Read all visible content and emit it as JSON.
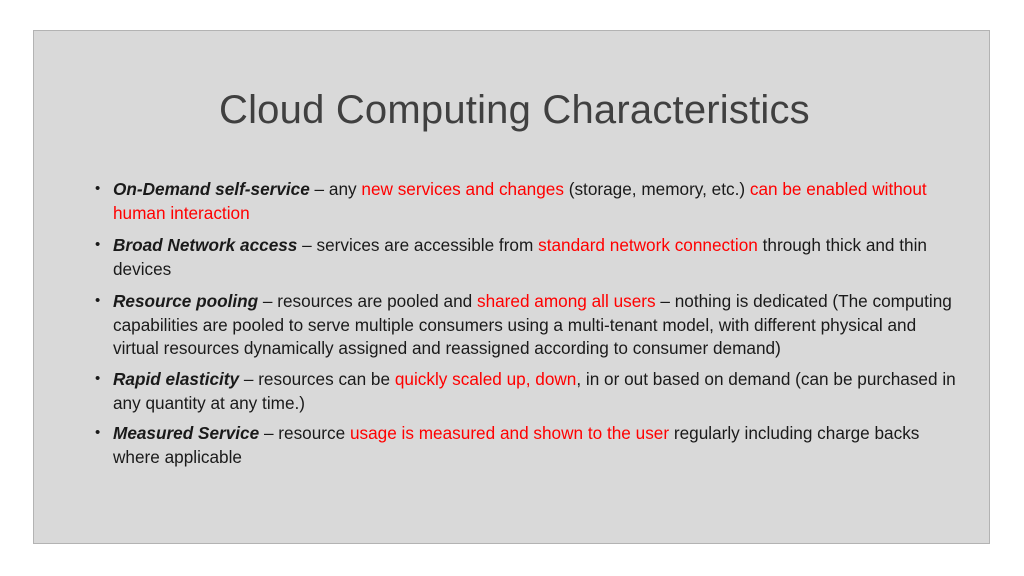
{
  "slide": {
    "title": "Cloud Computing Characteristics",
    "accent_color": "#ff0000",
    "background_color": "#d9d9d9",
    "title_color": "#404040",
    "bullets": [
      {
        "parts": [
          {
            "text": "On-Demand self-service",
            "style": "term"
          },
          {
            "text": " – any ",
            "style": "plain"
          },
          {
            "text": "new services and changes",
            "style": "hl"
          },
          {
            "text": " (storage, memory, etc.) ",
            "style": "plain"
          },
          {
            "text": "can be enabled without human interaction",
            "style": "hl"
          }
        ]
      },
      {
        "parts": [
          {
            "text": "Broad Network access",
            "style": "term"
          },
          {
            "text": " – services are accessible from ",
            "style": "plain"
          },
          {
            "text": "standard network connection",
            "style": "hl"
          },
          {
            "text": " through thick and thin devices",
            "style": "plain"
          }
        ]
      },
      {
        "parts": [
          {
            "text": "Resource pooling",
            "style": "term"
          },
          {
            "text": " – resources are pooled and ",
            "style": "plain"
          },
          {
            "text": "shared among all users",
            "style": "hl"
          },
          {
            "text": " – nothing is dedicated (The computing capabilities are pooled to serve multiple consumers using a multi-tenant model, with different physical and virtual resources dynamically assigned and reassigned according to consumer demand)",
            "style": "plain"
          }
        ]
      },
      {
        "parts": [
          {
            "text": "Rapid elasticity",
            "style": "term"
          },
          {
            "text": " – resources can be ",
            "style": "plain"
          },
          {
            "text": "quickly scaled up, down",
            "style": "hl"
          },
          {
            "text": ", in or out based on demand (can be purchased in any quantity at any time.)",
            "style": "plain"
          }
        ]
      },
      {
        "parts": [
          {
            "text": "Measured Service",
            "style": "term"
          },
          {
            "text": " – resource ",
            "style": "plain"
          },
          {
            "text": "usage is measured and shown to the user",
            "style": "hl"
          },
          {
            "text": " regularly including charge backs where applicable",
            "style": "plain"
          }
        ]
      }
    ]
  }
}
